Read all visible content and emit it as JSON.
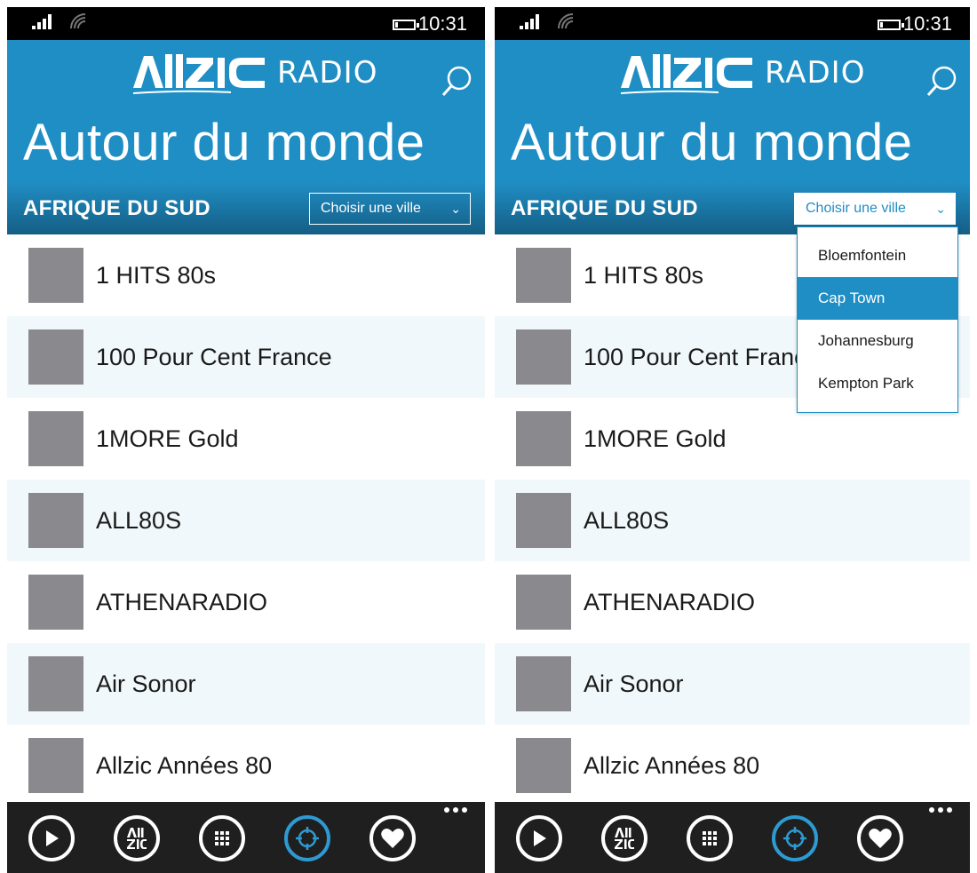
{
  "screens": [
    {
      "status": {
        "time": "10:31"
      },
      "header": {
        "brand": "RADIO",
        "page_title": "Autour du monde"
      },
      "filter": {
        "country": "AFRIQUE DU SUD",
        "city_select": "Choisir une ville",
        "dropdown_open": false
      },
      "stations": [
        "1 HITS 80s",
        "100 Pour Cent France",
        "1MORE Gold",
        "ALL80S",
        "ATHENARADIO",
        "Air Sonor",
        "Allzic Années 80"
      ],
      "appbar": {
        "icons": [
          "play-icon",
          "allzic-icon",
          "grid-icon",
          "locate-icon",
          "heart-icon"
        ],
        "active": "locate-icon"
      }
    },
    {
      "status": {
        "time": "10:31"
      },
      "header": {
        "brand": "RADIO",
        "page_title": "Autour du monde"
      },
      "filter": {
        "country": "AFRIQUE DU SUD",
        "city_select": "Choisir une ville",
        "dropdown_open": true
      },
      "stations": [
        "1 HITS 80s",
        "100 Pour Cent France",
        "1MORE Gold",
        "ALL80S",
        "ATHENARADIO",
        "Air Sonor",
        "Allzic Années 80"
      ],
      "appbar": {
        "icons": [
          "play-icon",
          "allzic-icon",
          "grid-icon",
          "locate-icon",
          "heart-icon"
        ],
        "active": "locate-icon"
      }
    }
  ],
  "city_dropdown": {
    "options": [
      "Bloemfontein",
      "Cap Town",
      "Johannesburg",
      "Kempton Park"
    ],
    "selected": "Cap Town"
  },
  "colors": {
    "accent": "#1f8ec4",
    "appbar": "#1f1f1f",
    "thumb": "#8a898d",
    "active_icon": "#2e9ad2"
  }
}
